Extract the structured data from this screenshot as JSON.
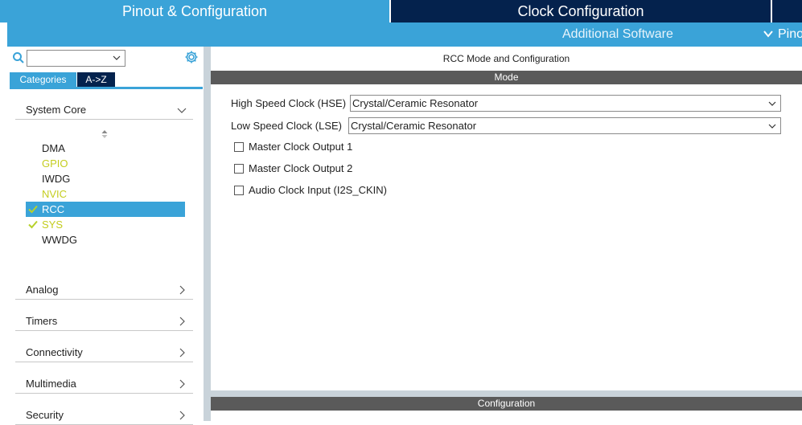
{
  "top_tabs": {
    "pinout": "Pinout & Configuration",
    "clock": "Clock Configuration"
  },
  "subbar": {
    "additional_software": "Additional Software",
    "pinout_view": "Pino"
  },
  "left": {
    "search": {
      "value": ""
    },
    "tabs": {
      "categories": "Categories",
      "az": "A->Z"
    },
    "sections": {
      "system_core": "System Core",
      "analog": "Analog",
      "timers": "Timers",
      "connectivity": "Connectivity",
      "multimedia": "Multimedia",
      "security": "Security"
    },
    "peripherals": [
      {
        "label": "DMA",
        "status": "normal"
      },
      {
        "label": "GPIO",
        "status": "warning"
      },
      {
        "label": "IWDG",
        "status": "normal"
      },
      {
        "label": "NVIC",
        "status": "warning"
      },
      {
        "label": "RCC",
        "status": "selected",
        "checked": true
      },
      {
        "label": "SYS",
        "status": "warning",
        "checked": true
      },
      {
        "label": "WWDG",
        "status": "normal"
      }
    ]
  },
  "right": {
    "title": "RCC Mode and Configuration",
    "mode_header": "Mode",
    "hse": {
      "label": "High Speed Clock (HSE)",
      "value": "Crystal/Ceramic Resonator"
    },
    "lse": {
      "label": "Low Speed Clock (LSE)",
      "value": "Crystal/Ceramic Resonator"
    },
    "checkboxes": [
      {
        "label": "Master Clock Output 1",
        "checked": false
      },
      {
        "label": "Master Clock Output 2",
        "checked": false
      },
      {
        "label": "Audio Clock Input (I2S_CKIN)",
        "checked": false
      }
    ],
    "config_header": "Configuration"
  },
  "colors": {
    "accent_blue": "#3aa3d8",
    "dark_navy": "#04224d",
    "header_grey": "#5a5a5a",
    "warning_yellow": "#c4cd1e",
    "check_green": "#b7d12b"
  }
}
